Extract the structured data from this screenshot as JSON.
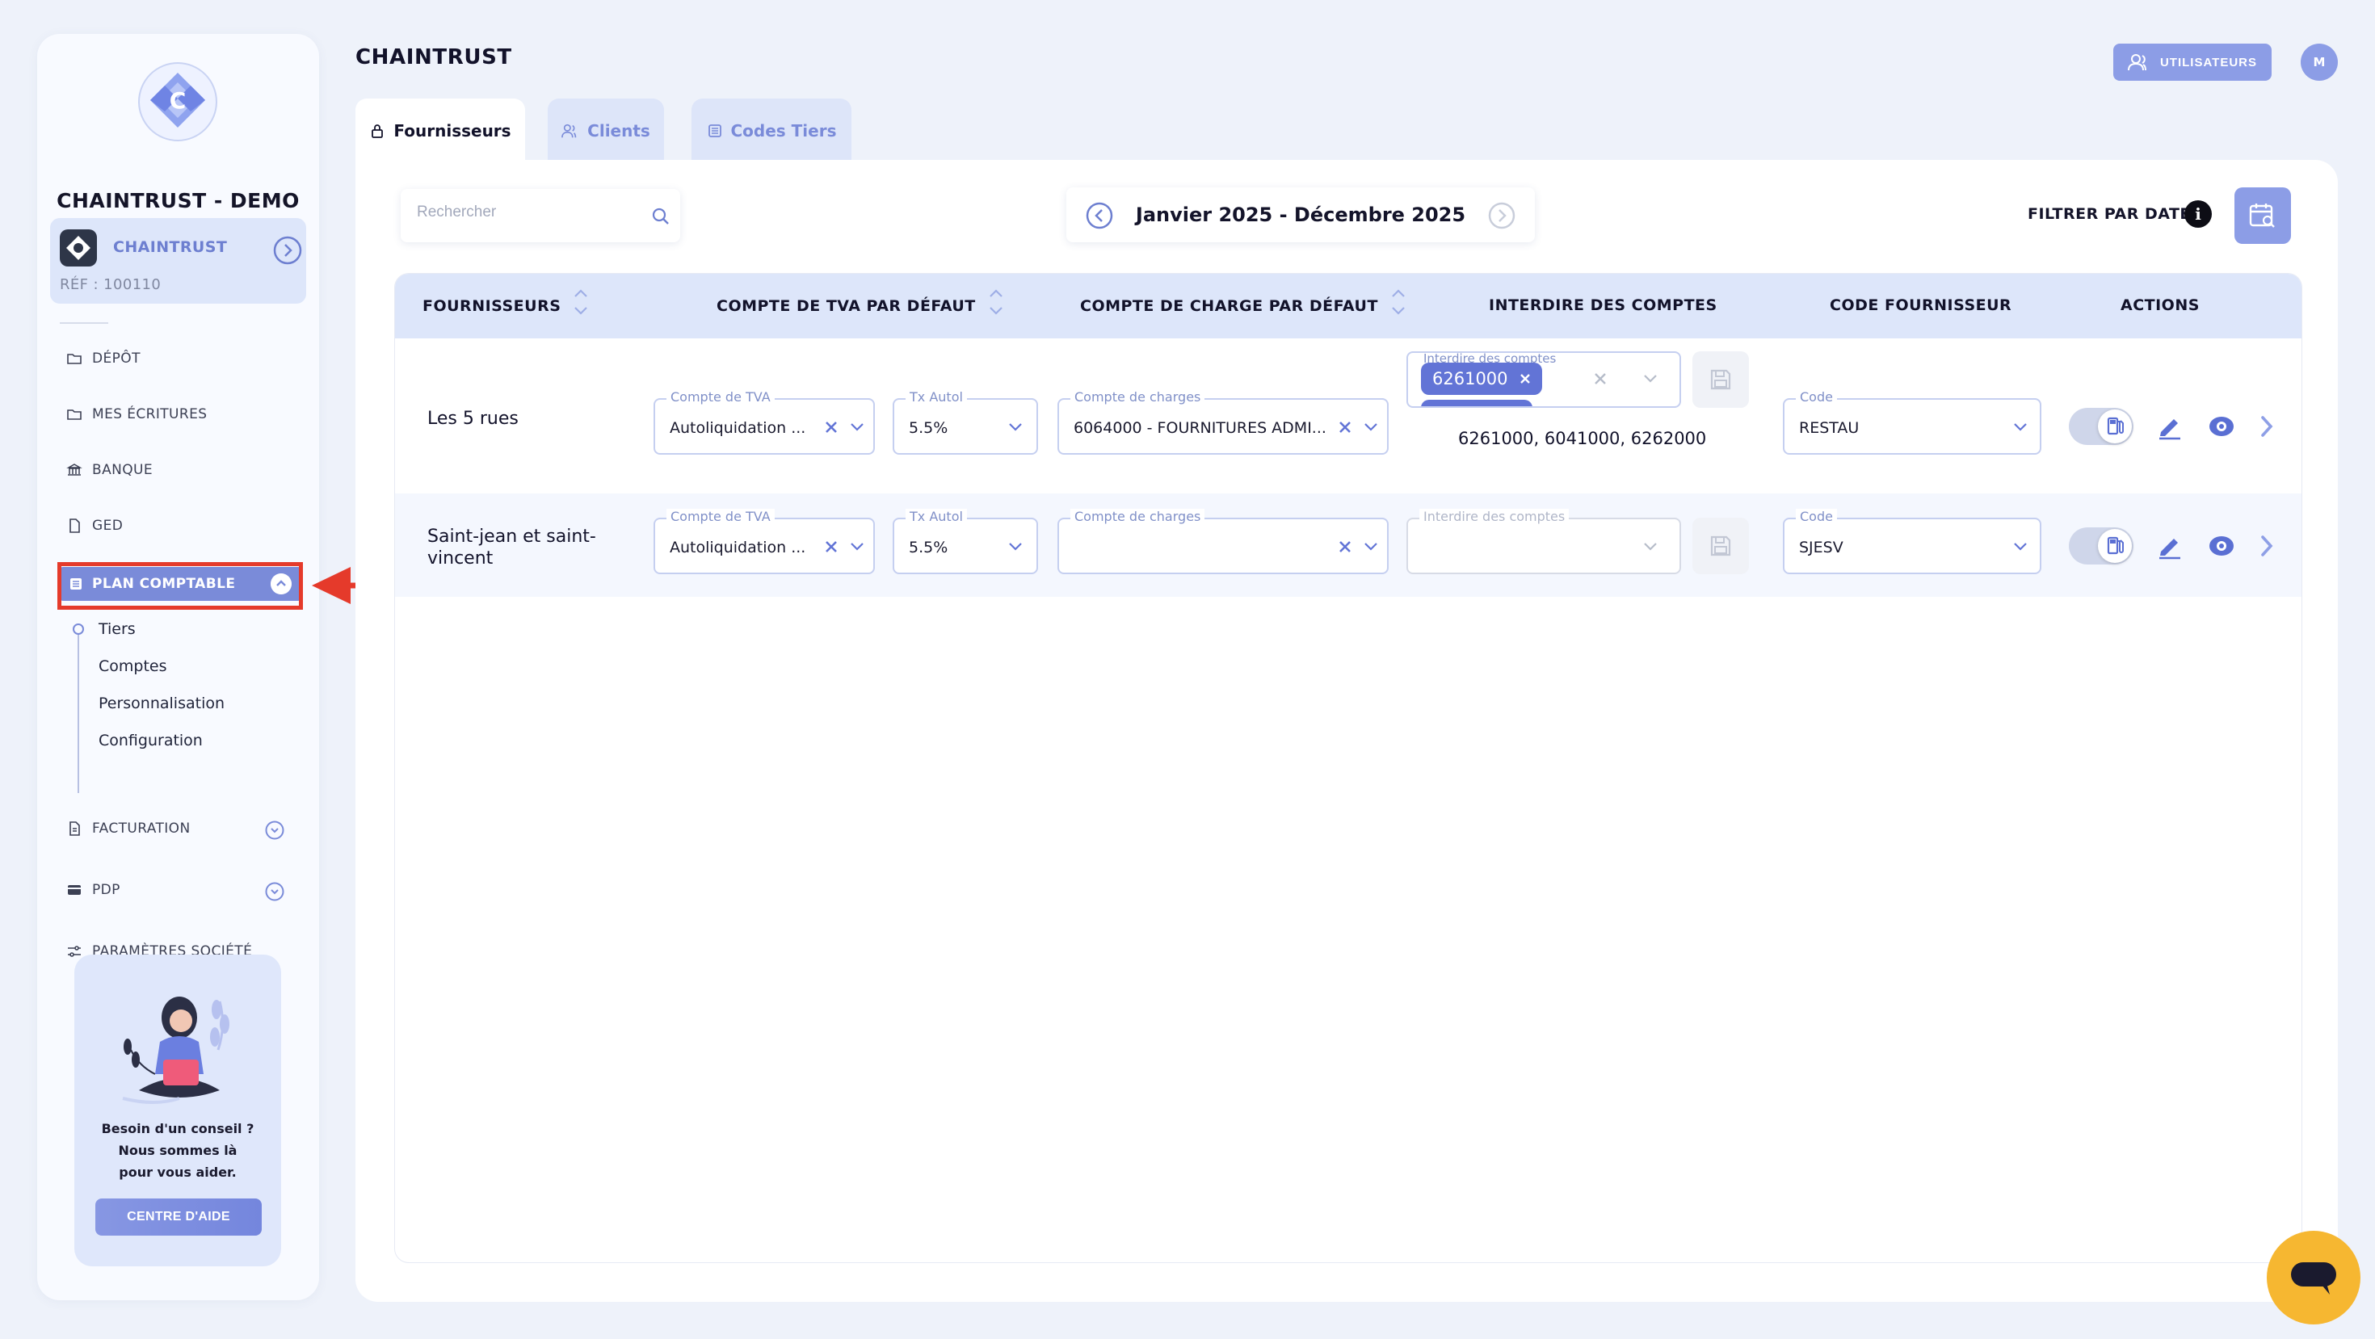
{
  "sidebar": {
    "brand": "CHAINTRUST - DEMO",
    "company": {
      "name": "CHAINTRUST",
      "ref": "RÉF : 100110"
    },
    "nav": [
      {
        "label": "DÉPÔT",
        "icon": "folder-icon"
      },
      {
        "label": "MES ÉCRITURES",
        "icon": "folder-icon"
      },
      {
        "label": "BANQUE",
        "icon": "bank-icon"
      },
      {
        "label": "GED",
        "icon": "document-icon"
      }
    ],
    "active": {
      "label": "PLAN COMPTABLE",
      "icon": "list-icon"
    },
    "sub_items": [
      "Tiers",
      "Comptes",
      "Personnalisation",
      "Configuration"
    ],
    "nav_bottom": [
      {
        "label": "FACTURATION",
        "icon": "invoice-icon"
      },
      {
        "label": "PDP",
        "icon": "card-icon"
      },
      {
        "label": "PARAMÈTRES SOCIÉTÉ",
        "icon": "sliders-icon"
      }
    ],
    "help": {
      "line1": "Besoin d'un conseil ?",
      "line2": "Nous sommes là",
      "line3": "pour vous aider.",
      "button": "CENTRE D'AIDE"
    }
  },
  "header": {
    "title": "CHAINTRUST",
    "users_button": "UTILISATEURS",
    "avatar": "M"
  },
  "tabs": [
    {
      "label": "Fournisseurs",
      "active": true
    },
    {
      "label": "Clients",
      "active": false
    },
    {
      "label": "Codes Tiers",
      "active": false
    }
  ],
  "toolbar": {
    "search_placeholder": "Rechercher",
    "date_range": "Janvier 2025 - Décembre 2025",
    "filter_label": "FILTRER PAR DATE",
    "info": "i"
  },
  "table": {
    "columns": [
      "FOURNISSEURS",
      "COMPTE DE TVA PAR DÉFAUT",
      "COMPTE DE CHARGE PAR DÉFAUT",
      "INTERDIRE DES COMPTES",
      "CODE FOURNISSEUR",
      "ACTIONS"
    ],
    "field_labels": {
      "tva": "Compte de TVA",
      "tx": "Tx Autol",
      "charges": "Compte de charges",
      "forbid": "Interdire des comptes",
      "code": "Code"
    },
    "rows": [
      {
        "name": "Les 5 rues",
        "tva": "Autoliquidation ...",
        "tx": "5.5%",
        "charges": "6064000 - FOURNITURES ADMI...",
        "forbid_chip": "6261000",
        "forbid_tooltip": "6261000, 6041000, 6262000",
        "code": "RESTAU"
      },
      {
        "name_line1": "Saint-jean et saint-",
        "name_line2": "vincent",
        "tva": "Autoliquidation ...",
        "tx": "5.5%",
        "charges": "",
        "code": "SJESV"
      }
    ]
  },
  "colors": {
    "accent": "#7a8bd9",
    "chip": "#6274d6",
    "header_bg": "#dde6fa",
    "highlight": "#e53a2b",
    "chat": "#f6b731"
  }
}
